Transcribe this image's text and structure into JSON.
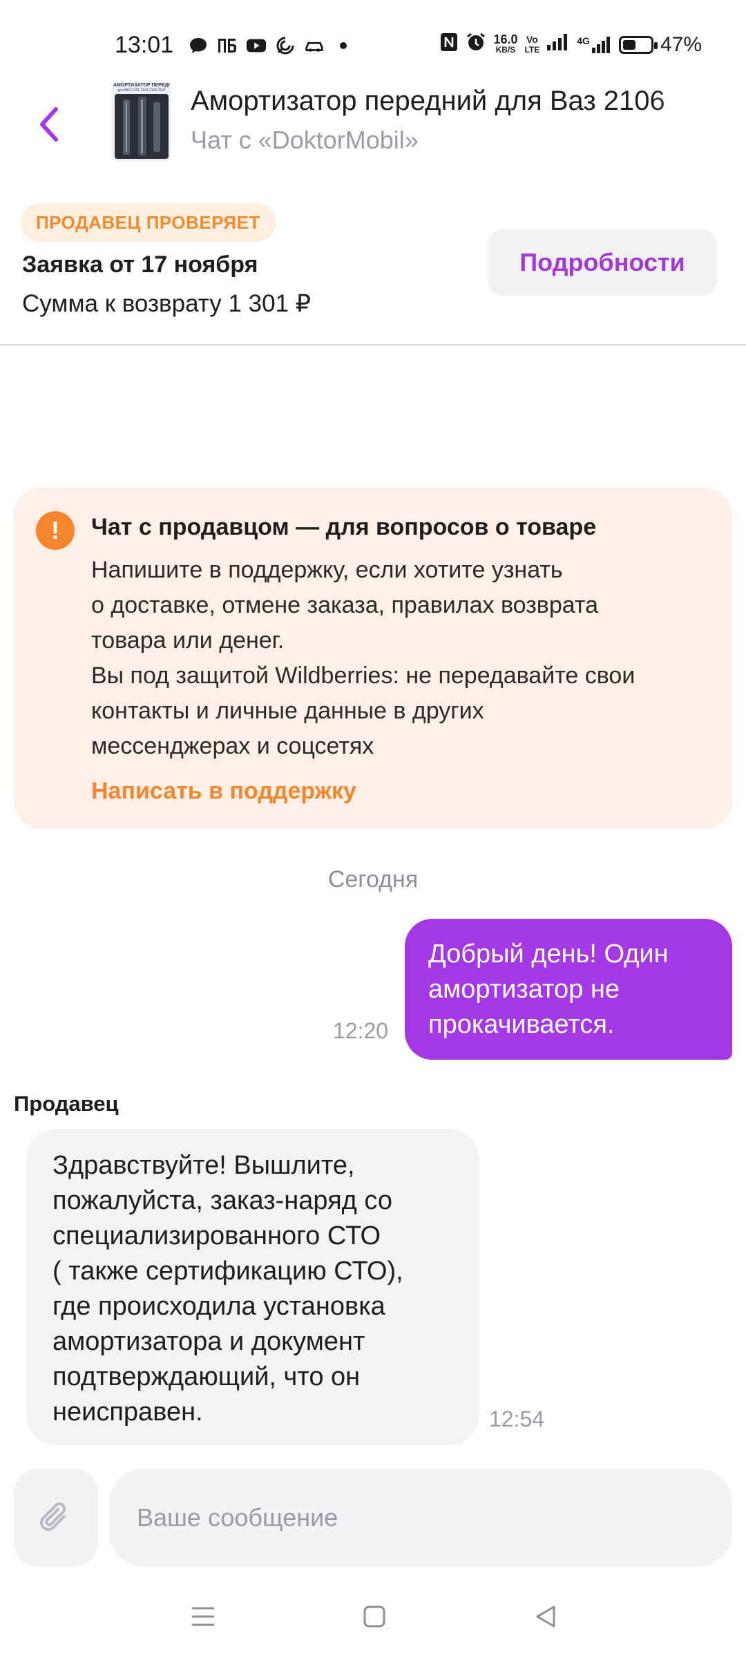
{
  "status_bar": {
    "time": "13:01",
    "net_speed_value": "16.0",
    "net_speed_unit": "KB/S",
    "volte_top": "Vo",
    "volte_bottom": "LTE",
    "network": "4G",
    "battery_percent": "47%",
    "battery_level": 0.47,
    "icons_left": [
      "chat-bubble-icon",
      "pb-bank-icon",
      "youtube-icon",
      "swirl-app-icon",
      "car-app-icon",
      "dot-icon"
    ],
    "icons_right": [
      "nfc-icon",
      "alarm-icon",
      "net-speed-icon",
      "volte-icon",
      "signal-icon",
      "signal-4g-icon",
      "battery-icon"
    ]
  },
  "header": {
    "title": "Амортизатор передний для Ваз 2106",
    "subtitle": "Чат с «DoktorMobil»",
    "thumb_label": "АМОРТИЗАТОР ПЕРЕДНИЙ",
    "thumb_sublabel": "для ВАЗ 2101 2103 2106 2107"
  },
  "request": {
    "status_badge": "ПРОДАВЕЦ ПРОВЕРЯЕТ",
    "title": "Заявка от 17 ноября",
    "refund_sum": "Сумма к возврату 1 301 ₽",
    "details_button": "Подробности"
  },
  "info_card": {
    "icon": "!",
    "title": "Чат с продавцом — для вопросов о товаре",
    "body_lines": [
      "Напишите в поддержку, если хотите узнать",
      "о доставке, отмене заказа, правилах возврата",
      "товара или денег.",
      "Вы под защитой Wildberries: не передавайте свои",
      "контакты и личные данные в других",
      "мессенджерах и соцсетях"
    ],
    "link": "Написать в поддержку"
  },
  "chat": {
    "date_separator": "Сегодня",
    "outgoing": {
      "lines": [
        "Добрый день! Один",
        "амортизатор не",
        "прокачивается."
      ],
      "time": "12:20"
    },
    "incoming": {
      "sender": "Продавец",
      "lines": [
        "Здравствуйте! Вышлите,",
        "пожалуйста, заказ-наряд со",
        "специализированного СТО",
        "( также сертификацию СТО),",
        "где происходила установка",
        "амортизатора и документ",
        "подтверждающий, что он",
        "неисправен."
      ],
      "time": "12:54"
    }
  },
  "composer": {
    "placeholder": "Ваше сообщение",
    "value": ""
  },
  "colors": {
    "accent": "#a437e6",
    "badge_text": "#f28b30",
    "warning": "#f5862e",
    "card_bg": "#fef0e7"
  }
}
